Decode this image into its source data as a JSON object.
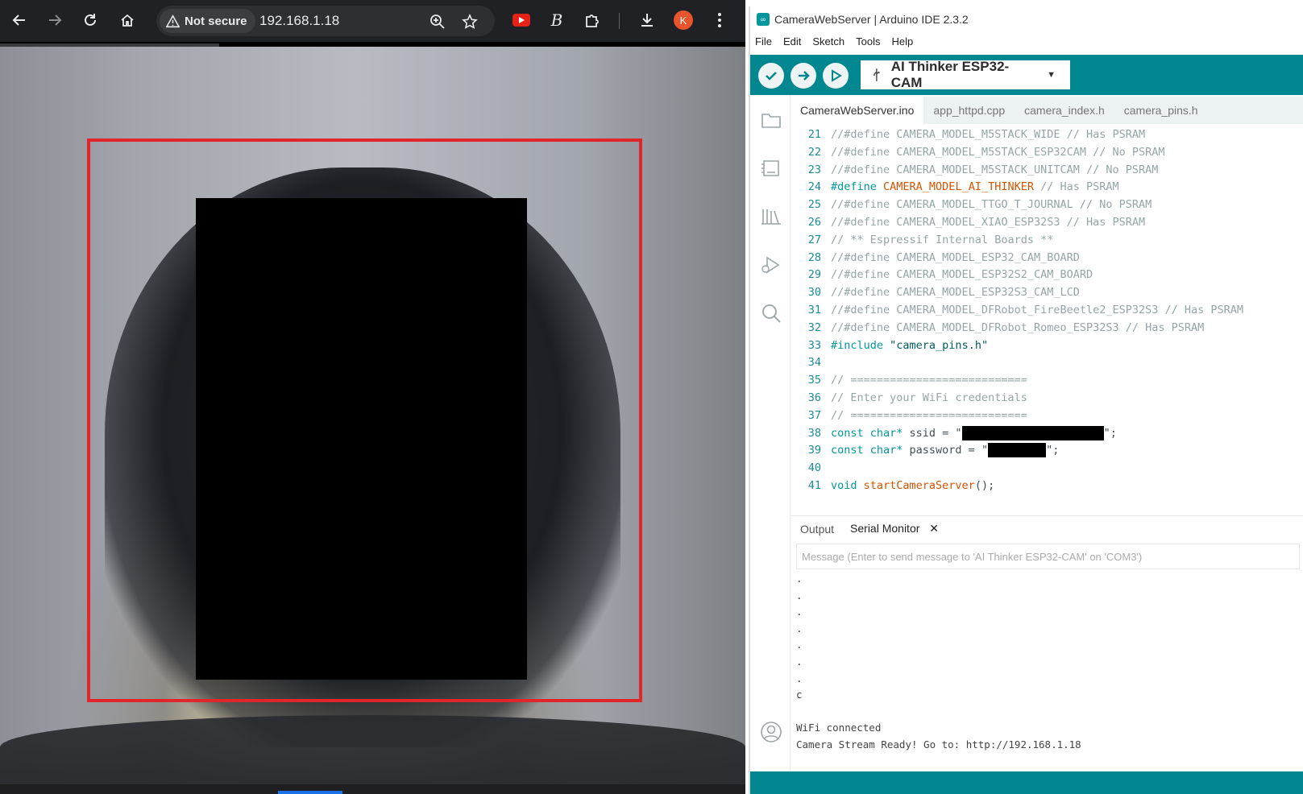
{
  "browser": {
    "security_label": "Not secure",
    "url": "192.168.1.18",
    "profile_initial": "K"
  },
  "camera": {
    "face_box_color": "#e0262a"
  },
  "ide": {
    "window_title": "CameraWebServer | Arduino IDE 2.3.2",
    "menu": [
      "File",
      "Edit",
      "Sketch",
      "Tools",
      "Help"
    ],
    "board": "AI Thinker ESP32-CAM",
    "tabs": [
      "CameraWebServer.ino",
      "app_httpd.cpp",
      "camera_index.h",
      "camera_pins.h"
    ],
    "code_lines": [
      {
        "n": "21",
        "t": "//#define CAMERA_MODEL_M5STACK_WIDE // Has PSRAM"
      },
      {
        "n": "22",
        "t": "//#define CAMERA_MODEL_M5STACK_ESP32CAM // No PSRAM"
      },
      {
        "n": "23",
        "t": "//#define CAMERA_MODEL_M5STACK_UNITCAM // No PSRAM"
      },
      {
        "n": "24",
        "kw": "#define",
        "fn": "CAMERA_MODEL_AI_THINKER",
        "c": "// Has PSRAM"
      },
      {
        "n": "25",
        "t": "//#define CAMERA_MODEL_TTGO_T_JOURNAL // No PSRAM"
      },
      {
        "n": "26",
        "t": "//#define CAMERA_MODEL_XIAO_ESP32S3 // Has PSRAM"
      },
      {
        "n": "27",
        "t": "// ** Espressif Internal Boards **"
      },
      {
        "n": "28",
        "t": "//#define CAMERA_MODEL_ESP32_CAM_BOARD"
      },
      {
        "n": "29",
        "t": "//#define CAMERA_MODEL_ESP32S2_CAM_BOARD"
      },
      {
        "n": "30",
        "t": "//#define CAMERA_MODEL_ESP32S3_CAM_LCD"
      },
      {
        "n": "31",
        "t": "//#define CAMERA_MODEL_DFRobot_FireBeetle2_ESP32S3 // Has PSRAM"
      },
      {
        "n": "32",
        "t": "//#define CAMERA_MODEL_DFRobot_Romeo_ESP32S3 // Has PSRAM"
      },
      {
        "n": "33",
        "kw": "#include",
        "s": "\"camera_pins.h\""
      },
      {
        "n": "34",
        "t": ""
      },
      {
        "n": "35",
        "t": "// ==========================="
      },
      {
        "n": "36",
        "t": "// Enter your WiFi credentials"
      },
      {
        "n": "37",
        "t": "// ==========================="
      },
      {
        "n": "38",
        "kw": "const char*",
        "p": " ssid = \"",
        "tail": "\";"
      },
      {
        "n": "39",
        "kw": "const char*",
        "p": " password = \"",
        "tail": "\";"
      },
      {
        "n": "40",
        "t": ""
      },
      {
        "n": "41",
        "kw": "void",
        "fn": "startCameraServer",
        "p": "();"
      }
    ],
    "panel_tabs": [
      "Output",
      "Serial Monitor"
    ],
    "message_placeholder": "Message (Enter to send message to 'AI Thinker ESP32-CAM' on 'COM3')",
    "serial_lines": [
      ".",
      ".",
      ".",
      ".",
      ".",
      ".",
      ".",
      "c",
      "",
      "WiFi connected",
      "Camera Stream Ready! Go to: http://192.168.1.18"
    ]
  }
}
